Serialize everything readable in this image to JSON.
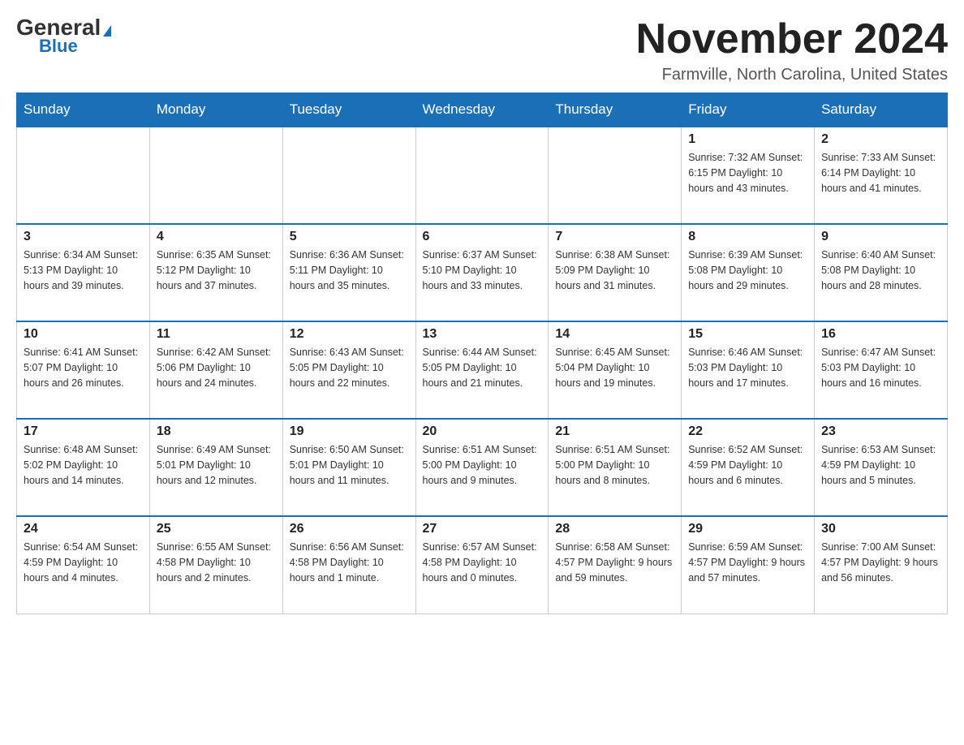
{
  "logo": {
    "general": "General",
    "blue": "Blue",
    "triangle": "▲"
  },
  "title": "November 2024",
  "location": "Farmville, North Carolina, United States",
  "days_of_week": [
    "Sunday",
    "Monday",
    "Tuesday",
    "Wednesday",
    "Thursday",
    "Friday",
    "Saturday"
  ],
  "weeks": [
    [
      {
        "day": "",
        "info": ""
      },
      {
        "day": "",
        "info": ""
      },
      {
        "day": "",
        "info": ""
      },
      {
        "day": "",
        "info": ""
      },
      {
        "day": "",
        "info": ""
      },
      {
        "day": "1",
        "info": "Sunrise: 7:32 AM\nSunset: 6:15 PM\nDaylight: 10 hours\nand 43 minutes."
      },
      {
        "day": "2",
        "info": "Sunrise: 7:33 AM\nSunset: 6:14 PM\nDaylight: 10 hours\nand 41 minutes."
      }
    ],
    [
      {
        "day": "3",
        "info": "Sunrise: 6:34 AM\nSunset: 5:13 PM\nDaylight: 10 hours\nand 39 minutes."
      },
      {
        "day": "4",
        "info": "Sunrise: 6:35 AM\nSunset: 5:12 PM\nDaylight: 10 hours\nand 37 minutes."
      },
      {
        "day": "5",
        "info": "Sunrise: 6:36 AM\nSunset: 5:11 PM\nDaylight: 10 hours\nand 35 minutes."
      },
      {
        "day": "6",
        "info": "Sunrise: 6:37 AM\nSunset: 5:10 PM\nDaylight: 10 hours\nand 33 minutes."
      },
      {
        "day": "7",
        "info": "Sunrise: 6:38 AM\nSunset: 5:09 PM\nDaylight: 10 hours\nand 31 minutes."
      },
      {
        "day": "8",
        "info": "Sunrise: 6:39 AM\nSunset: 5:08 PM\nDaylight: 10 hours\nand 29 minutes."
      },
      {
        "day": "9",
        "info": "Sunrise: 6:40 AM\nSunset: 5:08 PM\nDaylight: 10 hours\nand 28 minutes."
      }
    ],
    [
      {
        "day": "10",
        "info": "Sunrise: 6:41 AM\nSunset: 5:07 PM\nDaylight: 10 hours\nand 26 minutes."
      },
      {
        "day": "11",
        "info": "Sunrise: 6:42 AM\nSunset: 5:06 PM\nDaylight: 10 hours\nand 24 minutes."
      },
      {
        "day": "12",
        "info": "Sunrise: 6:43 AM\nSunset: 5:05 PM\nDaylight: 10 hours\nand 22 minutes."
      },
      {
        "day": "13",
        "info": "Sunrise: 6:44 AM\nSunset: 5:05 PM\nDaylight: 10 hours\nand 21 minutes."
      },
      {
        "day": "14",
        "info": "Sunrise: 6:45 AM\nSunset: 5:04 PM\nDaylight: 10 hours\nand 19 minutes."
      },
      {
        "day": "15",
        "info": "Sunrise: 6:46 AM\nSunset: 5:03 PM\nDaylight: 10 hours\nand 17 minutes."
      },
      {
        "day": "16",
        "info": "Sunrise: 6:47 AM\nSunset: 5:03 PM\nDaylight: 10 hours\nand 16 minutes."
      }
    ],
    [
      {
        "day": "17",
        "info": "Sunrise: 6:48 AM\nSunset: 5:02 PM\nDaylight: 10 hours\nand 14 minutes."
      },
      {
        "day": "18",
        "info": "Sunrise: 6:49 AM\nSunset: 5:01 PM\nDaylight: 10 hours\nand 12 minutes."
      },
      {
        "day": "19",
        "info": "Sunrise: 6:50 AM\nSunset: 5:01 PM\nDaylight: 10 hours\nand 11 minutes."
      },
      {
        "day": "20",
        "info": "Sunrise: 6:51 AM\nSunset: 5:00 PM\nDaylight: 10 hours\nand 9 minutes."
      },
      {
        "day": "21",
        "info": "Sunrise: 6:51 AM\nSunset: 5:00 PM\nDaylight: 10 hours\nand 8 minutes."
      },
      {
        "day": "22",
        "info": "Sunrise: 6:52 AM\nSunset: 4:59 PM\nDaylight: 10 hours\nand 6 minutes."
      },
      {
        "day": "23",
        "info": "Sunrise: 6:53 AM\nSunset: 4:59 PM\nDaylight: 10 hours\nand 5 minutes."
      }
    ],
    [
      {
        "day": "24",
        "info": "Sunrise: 6:54 AM\nSunset: 4:59 PM\nDaylight: 10 hours\nand 4 minutes."
      },
      {
        "day": "25",
        "info": "Sunrise: 6:55 AM\nSunset: 4:58 PM\nDaylight: 10 hours\nand 2 minutes."
      },
      {
        "day": "26",
        "info": "Sunrise: 6:56 AM\nSunset: 4:58 PM\nDaylight: 10 hours\nand 1 minute."
      },
      {
        "day": "27",
        "info": "Sunrise: 6:57 AM\nSunset: 4:58 PM\nDaylight: 10 hours\nand 0 minutes."
      },
      {
        "day": "28",
        "info": "Sunrise: 6:58 AM\nSunset: 4:57 PM\nDaylight: 9 hours\nand 59 minutes."
      },
      {
        "day": "29",
        "info": "Sunrise: 6:59 AM\nSunset: 4:57 PM\nDaylight: 9 hours\nand 57 minutes."
      },
      {
        "day": "30",
        "info": "Sunrise: 7:00 AM\nSunset: 4:57 PM\nDaylight: 9 hours\nand 56 minutes."
      }
    ]
  ]
}
